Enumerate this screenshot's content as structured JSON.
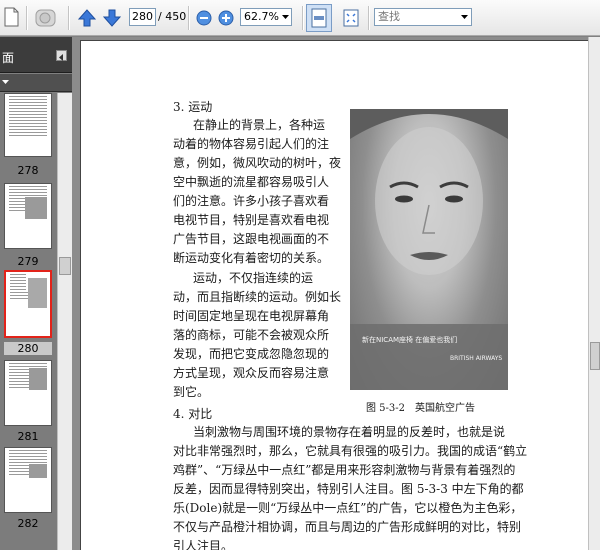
{
  "toolbar": {
    "current_page": "280",
    "total_pages": "/ 450",
    "zoom": "62.7%",
    "search_placeholder": "查找"
  },
  "sidebar": {
    "title": "面",
    "thumbnails": [
      {
        "label": "278",
        "selected": false
      },
      {
        "label": "279",
        "selected": false
      },
      {
        "label": "280",
        "selected": true
      },
      {
        "label": "281",
        "selected": false
      },
      {
        "label": "282",
        "selected": false
      }
    ]
  },
  "document": {
    "heading_motion": "3. 运动",
    "motion_lines": [
      "在静止的背景上，各种运",
      "动着的物体容易引起人们的注",
      "意，例如，微风吹动的树叶，夜",
      "空中飘逝的流星都容易吸引人",
      "们的注意。许多小孩子喜欢看",
      "电视节目，特别是喜欢看电视",
      "广告节目，这跟电视画面的不",
      "断运动变化有着密切的关系。",
      "运动，不仅指连续的运",
      "动，而且指断续的运动。例如长",
      "时间固定地呈现在电视屏幕角",
      "落的商标，可能不会被观众所",
      "发现，而把它变成忽隐忽现的",
      "方式呈现，观众反而容易注意",
      "到它。"
    ],
    "heading_contrast": "4. 对比",
    "contrast_lines": [
      "当刺激物与周围环境的景物存在着明显的反差时，也就是说",
      "对比非常强烈时，那么，它就具有很强的吸引力。我国的成语“鹤立",
      "鸡群”、“万绿丛中一点红”都是用来形容刺激物与背景有着强烈的",
      "反差，因而显得特别突出，特别引人注目。图 5-3-3 中左下角的都",
      "乐(Dole)就是一则“万绿丛中一点红”的广告，它以橙色为主色彩，",
      "不仅与产品橙汁相协调，而且与周边的广告形成鲜明的对比，特别",
      "引人注目。"
    ],
    "figure_caption": "图 5-3-2　英国航空广告",
    "photo_ad_text": "新在NICAM座椅  在偏爱也我们",
    "photo_brand": "BRITISH AIRWAYS"
  }
}
